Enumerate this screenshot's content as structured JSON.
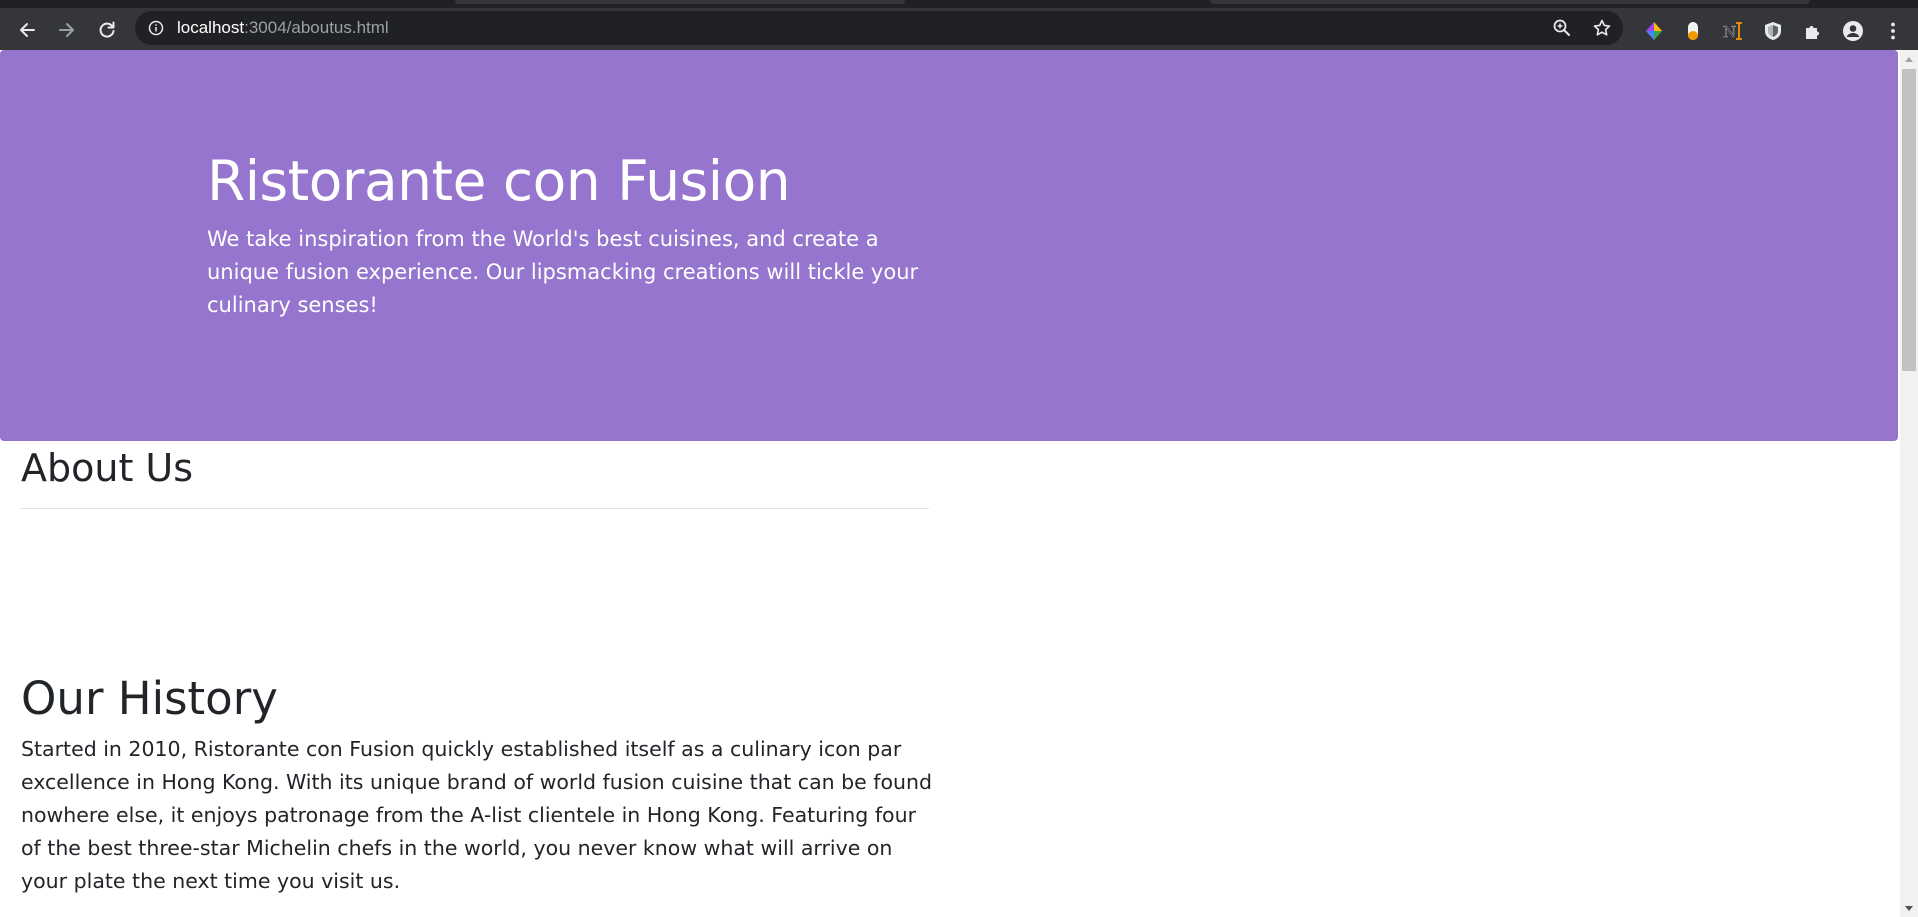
{
  "browser": {
    "url_host": "localhost",
    "url_path": ":3004/aboutus.html",
    "icons": {
      "back": "back-arrow-icon",
      "forward": "forward-arrow-icon",
      "reload": "reload-icon",
      "site_info": "info-icon",
      "zoom": "zoom-icon",
      "bookmark": "star-icon",
      "extensions": [
        "colorful-extension-icon",
        "pill-extension-icon",
        "ni-extension-icon",
        "shield-extension-icon",
        "puzzle-icon",
        "profile-icon",
        "menu-dots-icon"
      ]
    }
  },
  "hero": {
    "title": "Ristorante con Fusion",
    "lead": "We take inspiration from the World's best cuisines, and create a unique fusion experience. Our lipsmacking creations will tickle your culinary senses!",
    "background_color": "#9575cd"
  },
  "about": {
    "heading": "About Us"
  },
  "history": {
    "heading": "Our History",
    "paragraph": "Started in 2010, Ristorante con Fusion quickly established itself as a culinary icon par excellence in Hong Kong. With its unique brand of world fusion cuisine that can be found nowhere else, it enjoys patronage from the A-list clientele in Hong Kong. Featuring four of the best three-star Michelin chefs in the world, you never know what will arrive on your plate the next time you visit us."
  }
}
